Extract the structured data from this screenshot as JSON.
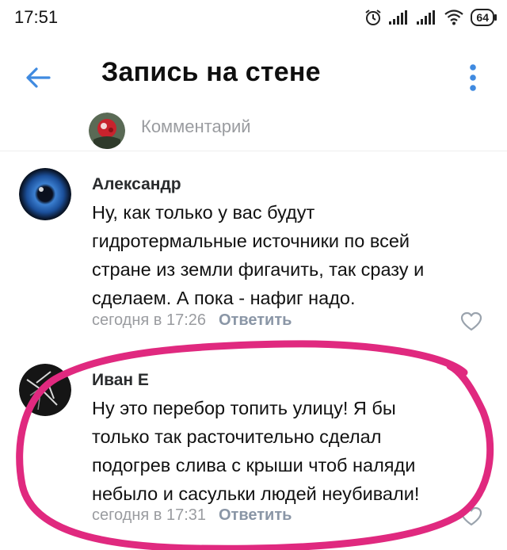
{
  "status_bar": {
    "time": "17:51",
    "battery": "64",
    "icons": [
      "alarm-icon",
      "signal-icon",
      "signal-icon",
      "wifi-icon",
      "battery-icon"
    ]
  },
  "header": {
    "title": "Запись на стене",
    "back_icon": "arrow-left-icon",
    "more_icon": "vertical-dots-icon",
    "accent": "#3f8ae0"
  },
  "comment_input": {
    "placeholder": "Комментарий"
  },
  "comments": [
    {
      "author": "Александр",
      "lines": [
        "Ну, как только у вас будут",
        "гидротермальные источники по всей",
        "стране из земли фигачить, так сразу и",
        "сделаем. А пока - нафиг надо."
      ],
      "time": "сегодня в 17:26",
      "reply_label": "Ответить"
    },
    {
      "author": "Иван Е",
      "lines": [
        "Ну это перебор топить улицу! Я бы",
        "только так расточительно сделал",
        "подогрев слива с крыши чтоб наляди",
        "небыло и сасульки людей неубивали!"
      ],
      "time": "сегодня в 17:31",
      "reply_label": "Ответить"
    }
  ],
  "highlight_color": "#e0297f"
}
